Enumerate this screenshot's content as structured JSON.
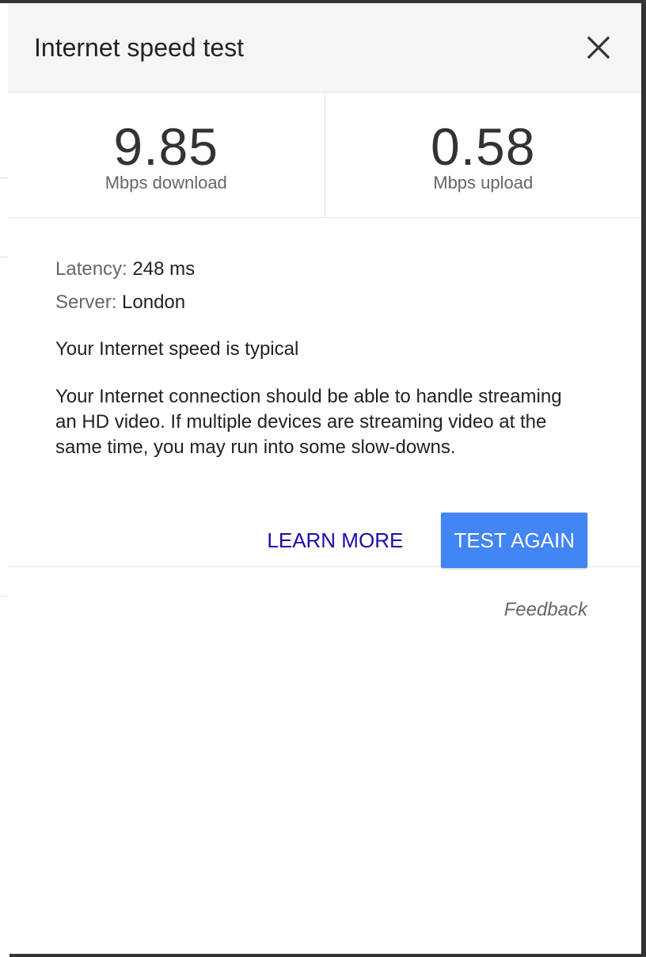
{
  "dialog": {
    "title": "Internet speed test",
    "close_icon": "close-icon"
  },
  "results": {
    "download": {
      "value": "9.85",
      "label": "Mbps download"
    },
    "upload": {
      "value": "0.58",
      "label": "Mbps upload"
    }
  },
  "details": {
    "latency_key": "Latency:",
    "latency_value": "248 ms",
    "server_key": "Server:",
    "server_value": "London",
    "verdict": "Your Internet speed is typical",
    "explanation": "Your Internet connection should be able to handle streaming an HD video. If multiple devices are streaming video at the same time, you may run into some slow-downs."
  },
  "actions": {
    "learn_more": "LEARN MORE",
    "test_again": "TEST AGAIN"
  },
  "footer": {
    "feedback": "Feedback"
  },
  "colors": {
    "primary_button": "#4285f4",
    "link": "#1a0dab",
    "header_bg": "#f5f5f5"
  }
}
